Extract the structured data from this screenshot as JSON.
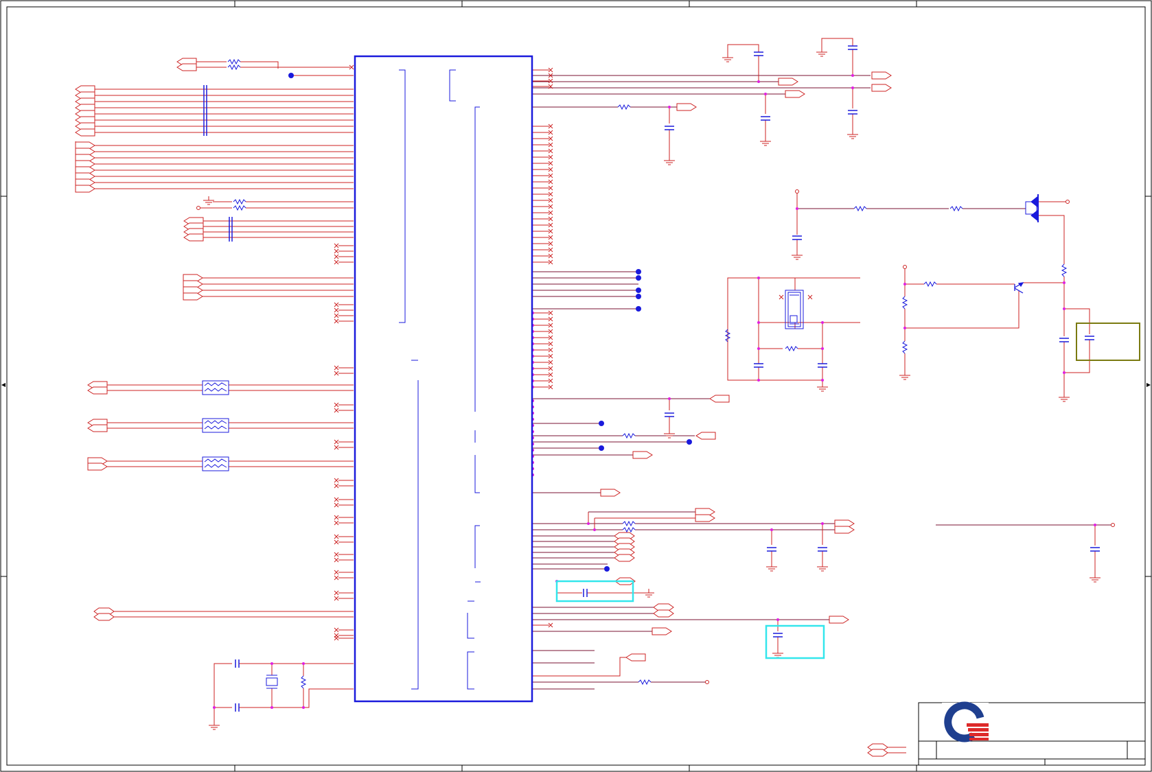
{
  "schematic": {
    "colors": {
      "wire": "#cc2222",
      "net": "#7a1030",
      "component": "#1a1adc",
      "junction": "#e020e0",
      "frame": "#000000",
      "highlight": "#33e6ec",
      "olive_box": "#7a7a10"
    },
    "logo": {
      "icon": "quanta-q-logo",
      "red": "#dd2a2a",
      "blue": "#1f3f8f"
    }
  }
}
